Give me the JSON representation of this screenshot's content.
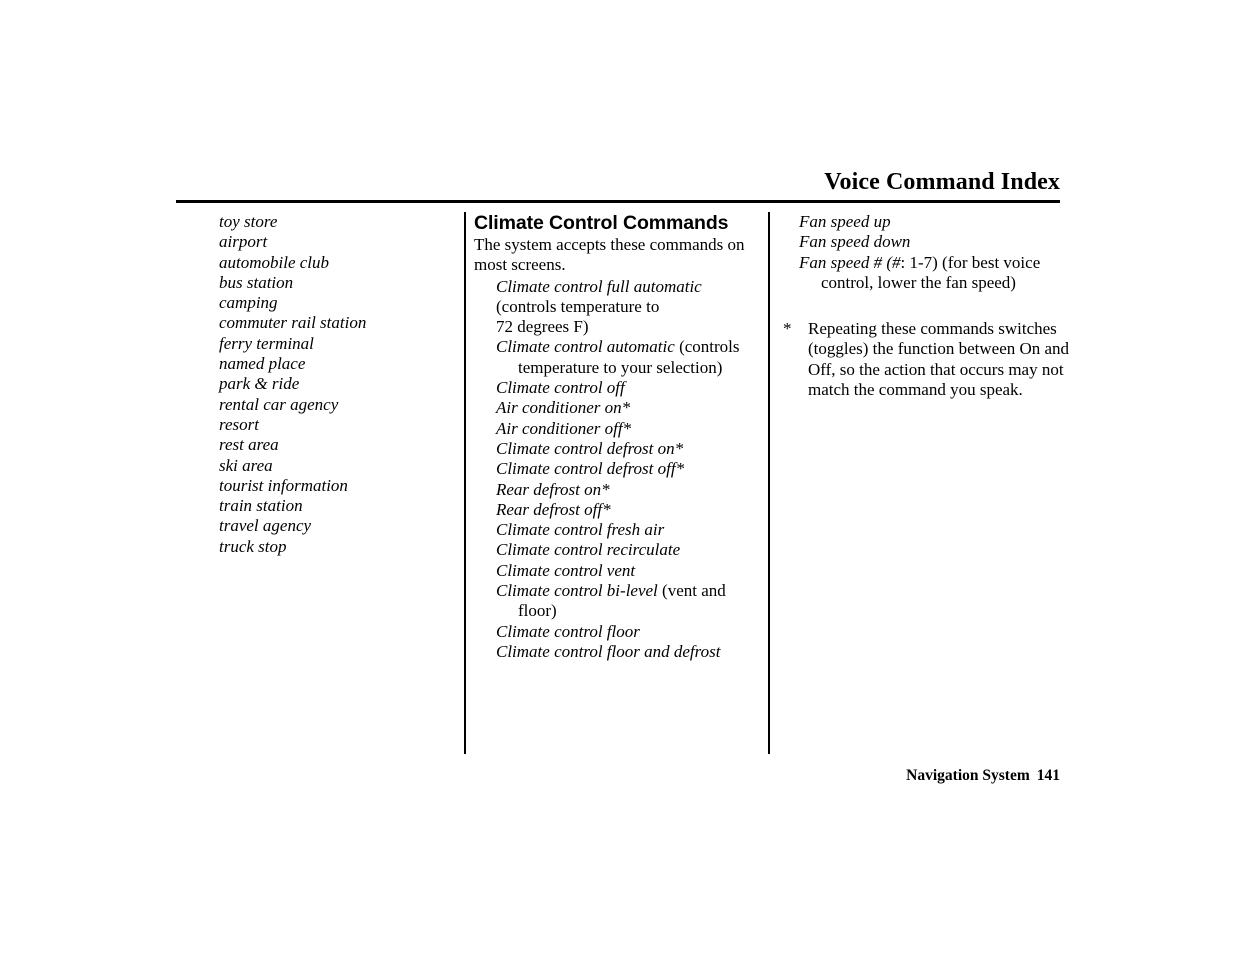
{
  "header": {
    "title": "Voice Command Index"
  },
  "columns": {
    "place_categories": {
      "items": [
        "toy store",
        "airport",
        "automobile club",
        "bus station",
        "camping",
        "commuter rail station",
        "ferry terminal",
        "named place",
        "park & ride",
        "rental car agency",
        "resort",
        "rest area",
        "ski area",
        "tourist information",
        "train station",
        "travel agency",
        "truck stop"
      ]
    },
    "climate_control": {
      "heading": "Climate Control Commands",
      "intro": "The system accepts these commands on most screens.",
      "commands": [
        {
          "command": "Climate control full automatic",
          "note_line1": "(controls temperature to",
          "note_line2": "72 degrees F)"
        },
        {
          "command": "Climate control automatic",
          "note": " (controls temperature to your selection)"
        },
        {
          "command": "Climate control off"
        },
        {
          "command": "Air conditioner on*"
        },
        {
          "command": "Air conditioner off*"
        },
        {
          "command": "Climate control defrost on*"
        },
        {
          "command": "Climate control defrost off*"
        },
        {
          "command": "Rear defrost on*"
        },
        {
          "command": "Rear defrost off*"
        },
        {
          "command": "Climate control fresh air"
        },
        {
          "command": "Climate control recirculate"
        },
        {
          "command": "Climate control vent"
        },
        {
          "command": "Climate control bi-level",
          "note": " (vent and floor)"
        },
        {
          "command": "Climate control floor"
        },
        {
          "command": "Climate control floor and defrost"
        }
      ]
    },
    "fan_and_footnote": {
      "commands": [
        {
          "command": "Fan speed up"
        },
        {
          "command": "Fan speed down"
        },
        {
          "command": "Fan speed # (#",
          "note": ": 1-7) (for best voice control, lower the fan speed)"
        }
      ],
      "footnote": {
        "marker": "*",
        "text": "Repeating these commands switches (toggles) the function between On and Off, so the action that occurs may not match the command you speak."
      }
    }
  },
  "footer": {
    "book_title": "Navigation System",
    "page_number": "141"
  }
}
